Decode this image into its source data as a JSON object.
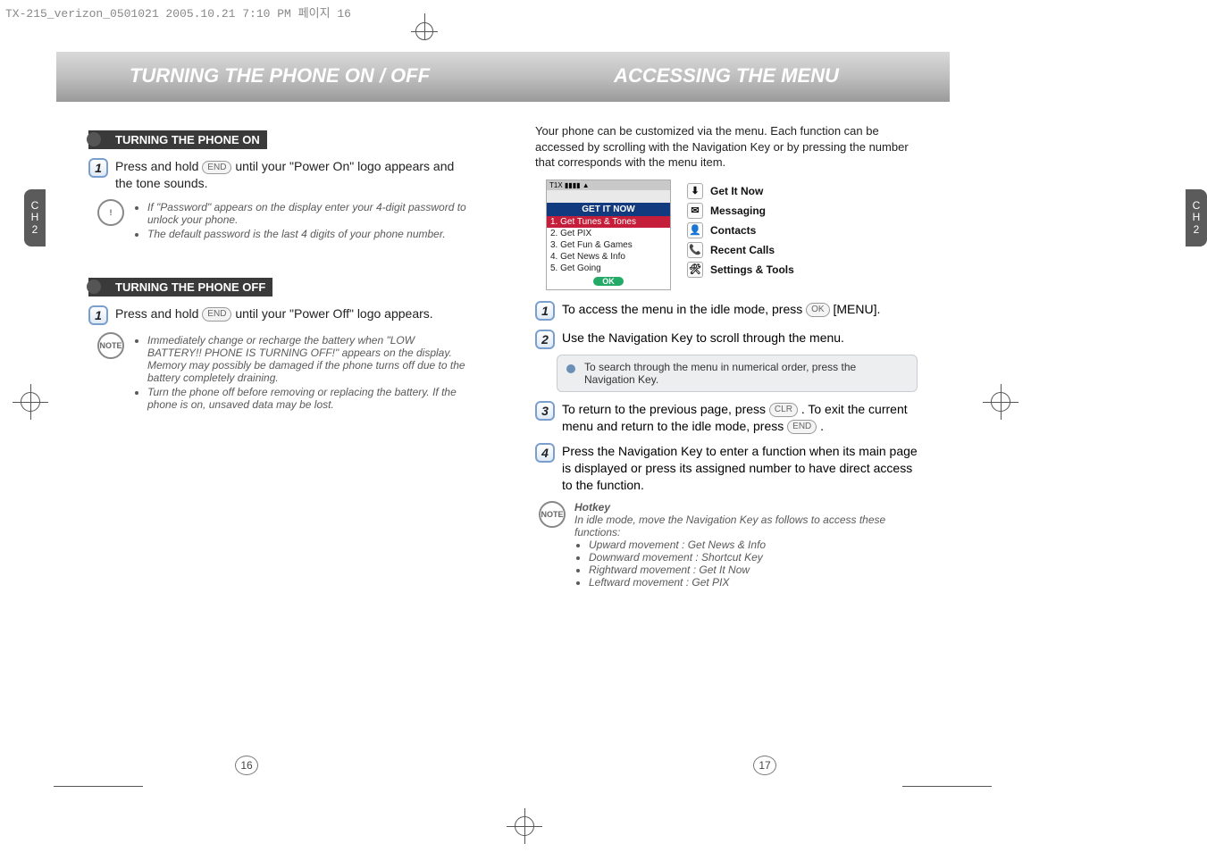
{
  "doc_tag": "TX-215_verizon_0501021  2005.10.21  7:10 PM  페이지 16",
  "left_page": {
    "title": "TURNING THE PHONE ON / OFF",
    "chapter_tab": {
      "line1": "C",
      "line2": "H",
      "line3": "2"
    },
    "section_on": "TURNING THE PHONE ON",
    "step_on": {
      "num": "1",
      "before_icon": "Press and hold ",
      "icon_label": "END",
      "after_icon": " until your \"Power On\" logo appears and the tone sounds."
    },
    "warn_on": [
      "If \"Password\" appears on the display enter your 4-digit password to unlock your phone.",
      "The default password is the last 4 digits of your phone number."
    ],
    "section_off": "TURNING THE PHONE OFF",
    "step_off": {
      "num": "1",
      "before_icon": "Press and hold ",
      "icon_label": "END",
      "after_icon": " until your \"Power Off\" logo appears."
    },
    "note_off": [
      "Immediately change or recharge the battery when \"LOW BATTERY!! PHONE IS TURNING OFF!\" appears on the display. Memory may possibly be damaged if the phone turns off due to the battery completely draining.",
      "Turn the phone off before removing or replacing the battery. If the phone is on, unsaved data may be lost."
    ],
    "page_number": "16"
  },
  "right_page": {
    "title": "ACCESSING THE MENU",
    "chapter_tab": {
      "line1": "C",
      "line2": "H",
      "line3": "2"
    },
    "intro": "Your phone can be customized via the menu. Each function can be accessed by scrolling with the Navigation Key or by pressing the number that corresponds with the menu item.",
    "phone_screen": {
      "banner": "GET IT NOW",
      "rows": [
        {
          "text": "1. Get Tunes & Tones",
          "selected": true
        },
        {
          "text": "2. Get PIX",
          "selected": false
        },
        {
          "text": "3. Get Fun & Games",
          "selected": false
        },
        {
          "text": "4. Get News & Info",
          "selected": false
        },
        {
          "text": "5. Get Going",
          "selected": false
        }
      ],
      "ok": "OK"
    },
    "side_menu": [
      {
        "icon": "⬇",
        "label": "Get It Now"
      },
      {
        "icon": "✉",
        "label": "Messaging"
      },
      {
        "icon": "👤",
        "label": "Contacts"
      },
      {
        "icon": "📞",
        "label": "Recent Calls"
      },
      {
        "icon": "🛠",
        "label": "Settings & Tools"
      }
    ],
    "steps": [
      {
        "num": "1",
        "text": "To access the menu in the idle mode, press ",
        "key": "OK",
        "after": " [MENU]."
      },
      {
        "num": "2",
        "text": "Use the Navigation Key to scroll through the menu."
      },
      {
        "num": "3",
        "text": "To return to the previous page, press ",
        "key": "CLR",
        "after": " . To exit the current menu and return to the idle mode, press ",
        "key2": "END",
        "after2": " ."
      },
      {
        "num": "4",
        "text": "Press the Navigation Key to enter a function when its main page is displayed or press its assigned number to have direct access to the function."
      }
    ],
    "tip": "To search through the menu in numerical order, press the Navigation Key.",
    "hotkey": {
      "title": "Hotkey",
      "intro": "In idle mode, move the Navigation Key as follows to access these functions:",
      "items": [
        "Upward movement : Get News & Info",
        "Downward movement : Shortcut Key",
        "Rightward movement : Get It Now",
        "Leftward movement : Get PIX"
      ]
    },
    "page_number": "17"
  },
  "icons": {
    "note_label": "NOTE",
    "warn_label": "!"
  }
}
